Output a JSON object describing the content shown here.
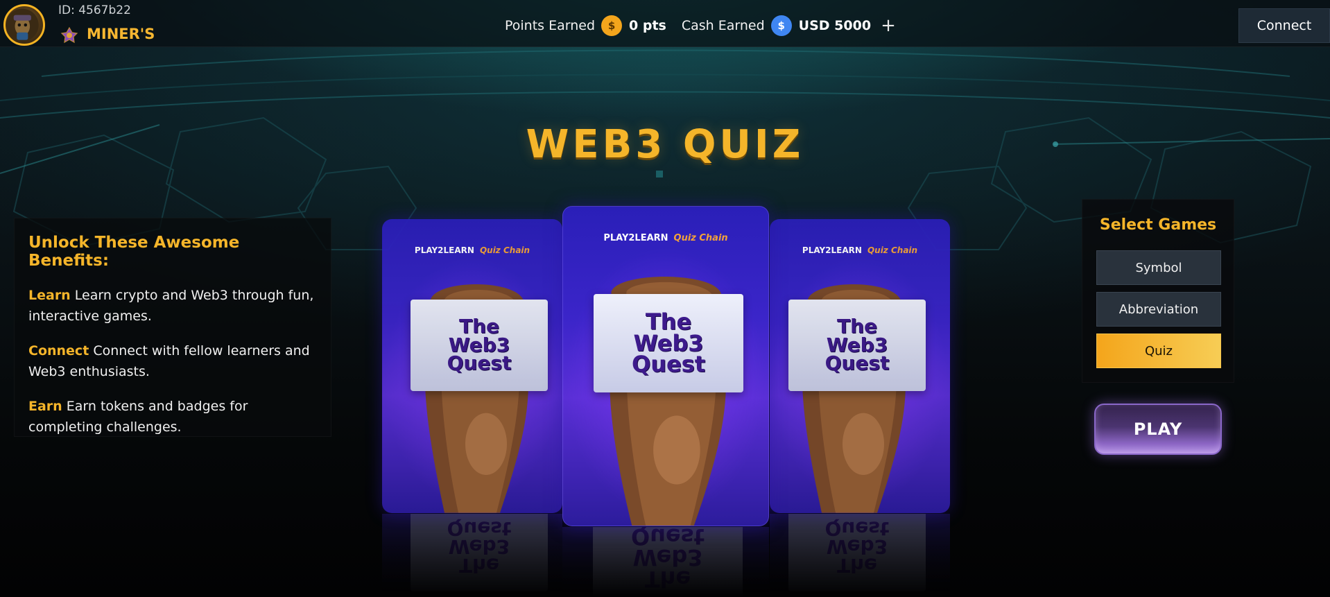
{
  "header": {
    "user_id": "ID: 4567b22",
    "rank_name": "MINER'S",
    "points_label": "Points Earned",
    "points_value": "0 pts",
    "cash_label": "Cash Earned",
    "cash_value": "USD 5000",
    "add_symbol": "+",
    "coin_gold_symbol": "$",
    "coin_blue_symbol": "$",
    "connect_label": "Connect"
  },
  "title": "WEB3 QUIZ",
  "benefits": {
    "heading": "Unlock These Awesome Benefits:",
    "items": [
      {
        "keyword": "Learn",
        "text": "Learn crypto and Web3 through fun, interactive games."
      },
      {
        "keyword": "Connect",
        "text": "Connect with fellow learners and Web3 enthusiasts."
      },
      {
        "keyword": "Earn",
        "text": "Earn tokens and badges for completing challenges."
      }
    ]
  },
  "cards": {
    "logo_play": "PLAY2LEARN",
    "logo_quiz": "Quiz Chain",
    "sign_text": "The\nWeb3\nQuest"
  },
  "select_games": {
    "heading": "Select Games",
    "options": [
      "Symbol",
      "Abbreviation",
      "Quiz"
    ],
    "selected": "Quiz"
  },
  "play_label": "PLAY",
  "colors": {
    "accent": "#f5b52a",
    "card_purple": "#3b25c9",
    "active_gradient_start": "#f4a51b",
    "active_gradient_end": "#f7cd55"
  }
}
